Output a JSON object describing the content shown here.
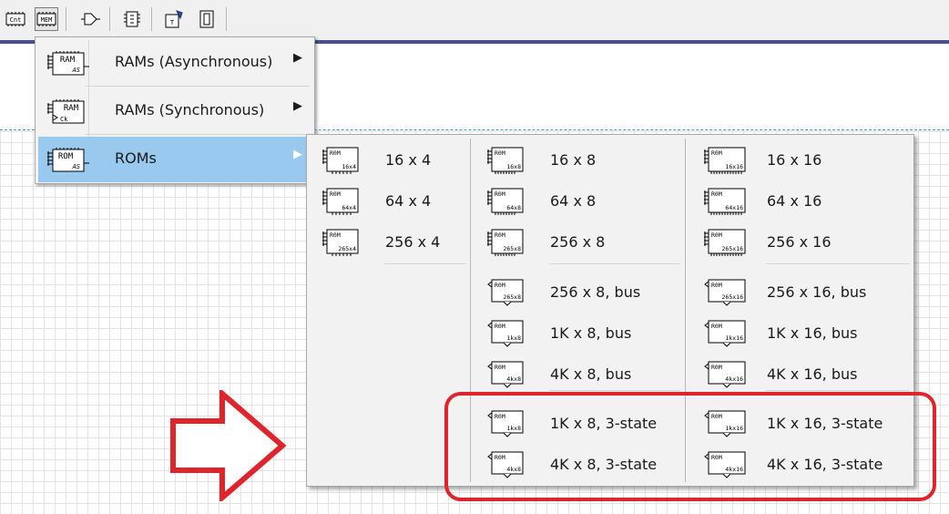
{
  "toolbar": {
    "buttons": [
      {
        "name": "counter-tool-icon",
        "label": "Cnt",
        "pressed": false
      },
      {
        "name": "memory-tool-icon",
        "label": "MEM",
        "pressed": true
      },
      {
        "name": "gate-tool-icon",
        "label": "",
        "pressed": false
      },
      {
        "name": "chip-tool-icon",
        "label": "",
        "pressed": false
      },
      {
        "name": "test-tool-icon",
        "label": "",
        "pressed": false
      },
      {
        "name": "display-tool-icon",
        "label": "",
        "pressed": false
      }
    ]
  },
  "memory_menu": {
    "items": [
      {
        "label": "RAMs (Asynchronous)",
        "icon_top": "RAM",
        "icon_bottom": "AS",
        "selected": false
      },
      {
        "label": "RAMs (Synchronous)",
        "icon_top": "RAM",
        "icon_bottom": "Ck",
        "selected": false
      },
      {
        "label": "ROMs",
        "icon_top": "ROM",
        "icon_bottom": "AS",
        "selected": true
      }
    ],
    "arrow": "▶"
  },
  "rom_menu": {
    "columns": [
      {
        "items": [
          {
            "label": "16 x 4",
            "icon_size": "16x4"
          },
          {
            "label": "64 x 4",
            "icon_size": "64x4"
          },
          {
            "label": "256 x 4",
            "icon_size": "265x4"
          }
        ]
      },
      {
        "items": [
          {
            "label": "16 x 8",
            "icon_size": "16x8"
          },
          {
            "label": "64 x 8",
            "icon_size": "64x8"
          },
          {
            "label": "256 x 8",
            "icon_size": "265x8"
          },
          {
            "label": "256 x 8, bus",
            "icon_size": "265x8"
          },
          {
            "label": "1K x 8, bus",
            "icon_size": "1kx8"
          },
          {
            "label": "4K x 8, bus",
            "icon_size": "4kx8"
          },
          {
            "label": "1K x 8, 3-state",
            "icon_size": "1kx8"
          },
          {
            "label": "4K x 8, 3-state",
            "icon_size": "4kx8"
          }
        ]
      },
      {
        "items": [
          {
            "label": "16 x 16",
            "icon_size": "16x16"
          },
          {
            "label": "64 x 16",
            "icon_size": "64x16"
          },
          {
            "label": "256 x 16",
            "icon_size": "265x16"
          },
          {
            "label": "256 x 16, bus",
            "icon_size": "265x16"
          },
          {
            "label": "1K x 16, bus",
            "icon_size": "1kx16"
          },
          {
            "label": "4K x 16, bus",
            "icon_size": "4kx16"
          },
          {
            "label": "1K x 16, 3-state",
            "icon_size": "1kx16"
          },
          {
            "label": "4K x 16, 3-state",
            "icon_size": "4kx16"
          }
        ]
      }
    ]
  },
  "annotation": {
    "color": "#e0242c",
    "arrow_icon": "right-arrow-icon",
    "highlight": "3-state ROM options"
  },
  "colors": {
    "menu_bg": "#f2f2f2",
    "selected_bg": "#99c9ef",
    "accent": "#4a4e8c",
    "grid": "#e3e3e3"
  }
}
